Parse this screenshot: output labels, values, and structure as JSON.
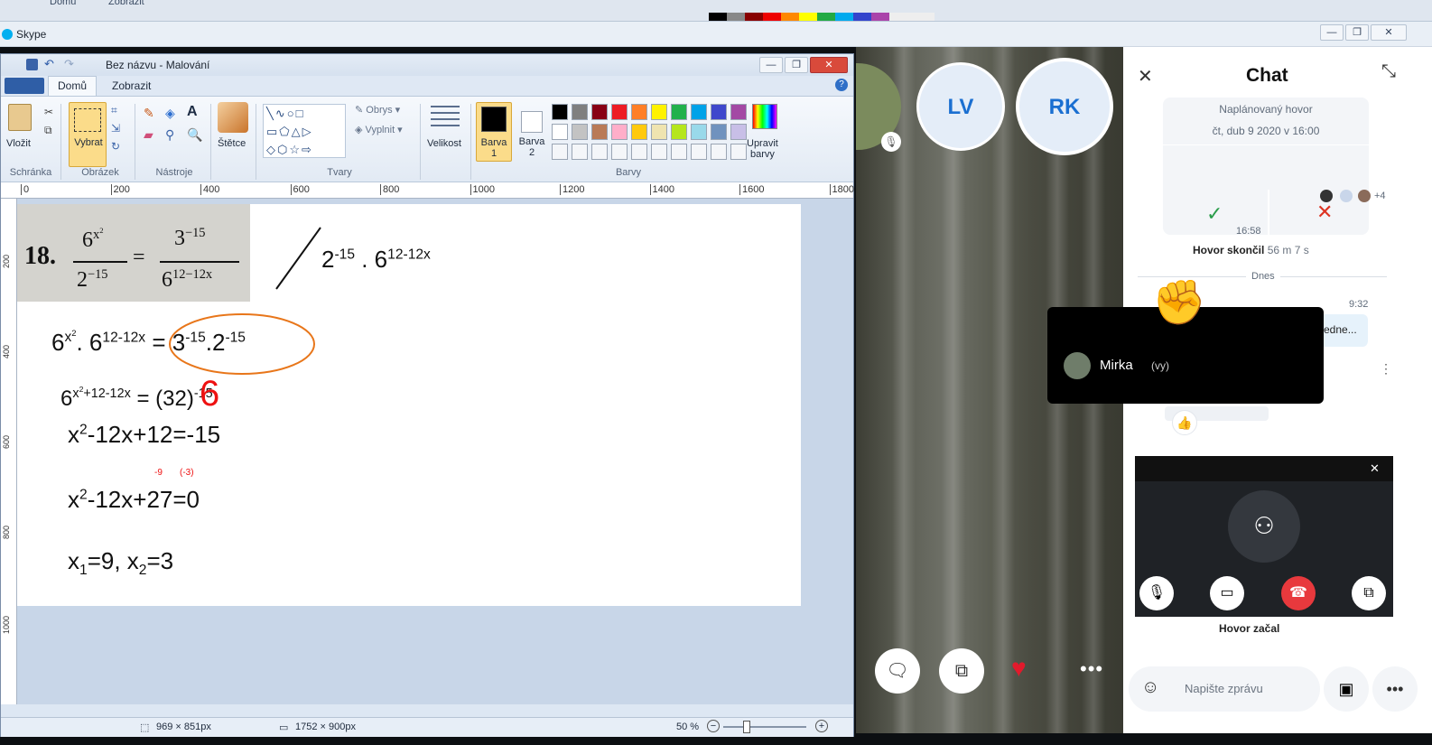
{
  "top_strip": {
    "tab_home": "Domů",
    "tab_view": "Zobrazit"
  },
  "skype": {
    "title": "Skype",
    "min": "—",
    "max": "❐",
    "close": "✕"
  },
  "paint": {
    "title": "Bez názvu - Malování",
    "tabs": {
      "home": "Domů",
      "view": "Zobrazit"
    },
    "clipboard": {
      "paste": "Vložit",
      "group": "Schránka"
    },
    "image": {
      "select": "Vybrat",
      "group": "Obrázek"
    },
    "tools": {
      "group": "Nástroje"
    },
    "brushes": {
      "label": "Štětce"
    },
    "shapes": {
      "outline": "Obrys",
      "fill": "Vyplnit",
      "group": "Tvary"
    },
    "size": {
      "label": "Velikost"
    },
    "colors": {
      "color1_a": "Barva",
      "color1_b": "1",
      "color2_a": "Barva",
      "color2_b": "2",
      "edit_a": "Upravit",
      "edit_b": "barvy",
      "group": "Barvy"
    },
    "palette": [
      "#000000",
      "#7f7f7f",
      "#880015",
      "#ed1c24",
      "#ff7f27",
      "#fff200",
      "#22b14c",
      "#00a2e8",
      "#3f48cc",
      "#a349a4",
      "#ffffff",
      "#c3c3c3",
      "#b97a57",
      "#ffaec9",
      "#ffc90e",
      "#efe4b0",
      "#b5e61d",
      "#99d9ea",
      "#7092be",
      "#c8bfe7"
    ],
    "ruler_ticks": [
      "0",
      "200",
      "400",
      "600",
      "800",
      "1000",
      "1200",
      "1400",
      "1600",
      "1800"
    ],
    "vruler_ticks": [
      "200",
      "400",
      "600",
      "800",
      "1000"
    ],
    "status": {
      "selection": "969 × 851px",
      "canvas": "1752 × 900px",
      "zoom": "50 %"
    },
    "math": {
      "problem_num": "18.",
      "p_num": "6",
      "p_num_exp": "x",
      "p_num_exp2": "2",
      "p_den": "2",
      "p_den_exp": "−15",
      "p_eq": "=",
      "p_rnum": "3",
      "p_rnum_exp": "−15",
      "p_rden": "6",
      "p_rden_exp": "12−12x",
      "l0_a": "2",
      "l0_ae": "-15",
      "l0_b": " . 6",
      "l0_be": "12-12x",
      "l1_a": "6",
      "l1_ae": "x",
      "l1_ae2": "2",
      "l1_b": ". 6",
      "l1_be": "12-12x",
      "l1_c": "= 3",
      "l1_ce": "-15",
      "l1_d": ".2",
      "l1_de": "-15",
      "l2_a": "6",
      "l2_ae": "x",
      "l2_ae2": "2",
      "l2_ae3": "+12-12x",
      "l2_b": "=  (3",
      "l2_c": "2)",
      "l2_ce": "-15",
      "l2_red": "6",
      "l3_a": "x",
      "l3_ae": "2",
      "l3_b": "-12x+12=-15",
      "l4_a": "x",
      "l4_ae": "2",
      "l4_b": "-12x+27=0",
      "l4_note1": "-9",
      "l4_note2": "(-3)",
      "l5_a": "x",
      "l5_as": "1",
      "l5_b": "=9,  x",
      "l5_bs": "2",
      "l5_c": "=3"
    }
  },
  "call": {
    "avatars": [
      "LV",
      "RK"
    ],
    "tooltip_name": "Mirka",
    "tooltip_you": "(vy)"
  },
  "chat": {
    "title": "Chat",
    "scheduled": "Naplánovaný hovor",
    "scheduled_date": "čt, dub 9 2020 v 16:00",
    "more_count": "+4",
    "time1": "16:58",
    "call_ended_bold": "Hovor skončil",
    "call_ended_dur": "56 m 7 s",
    "today": "Dnes",
    "time2": "9:32",
    "msg_snippet": "edne...",
    "call_started": "Hovor začal",
    "input_placeholder": "Napište zprávu"
  }
}
